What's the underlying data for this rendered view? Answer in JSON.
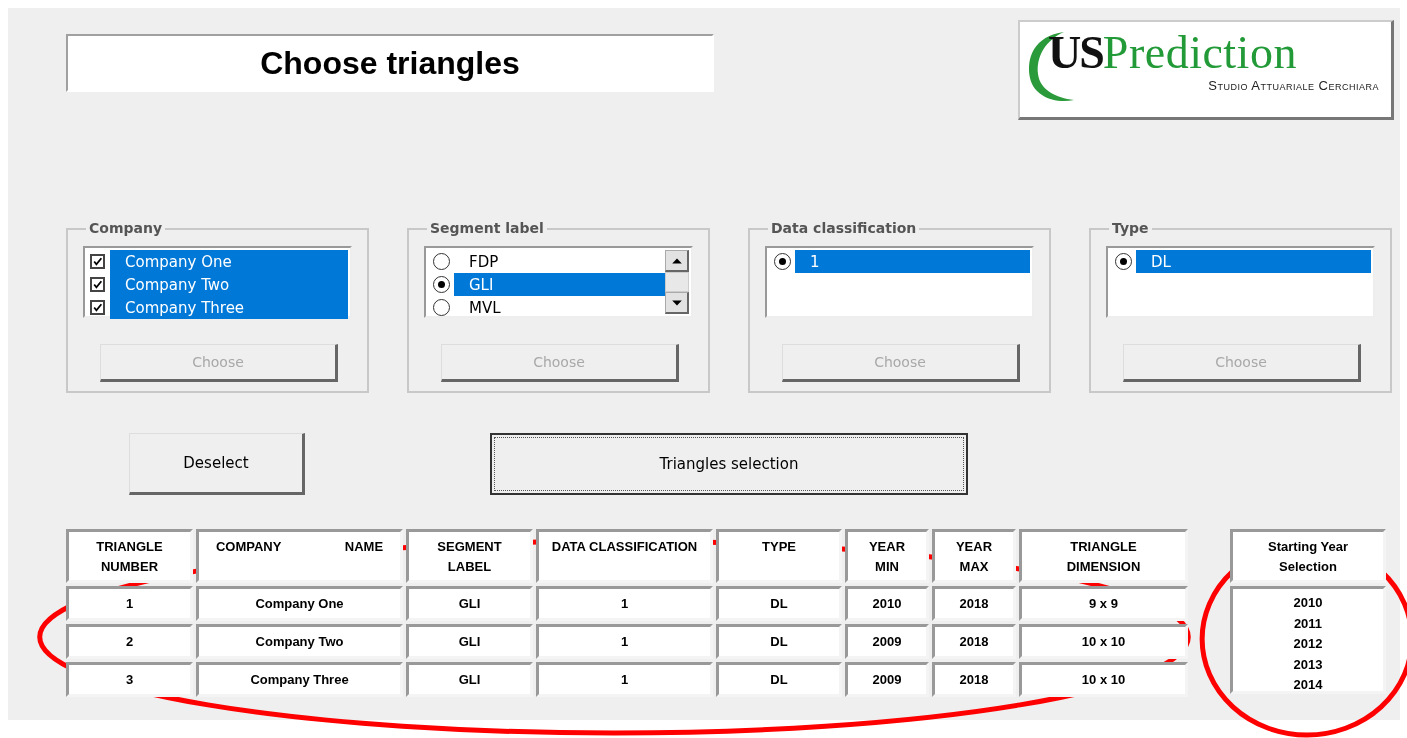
{
  "title": "Choose triangles",
  "logo": {
    "mark": "US",
    "word": "Prediction",
    "tagline": "Studio Attuariale Cerchiara"
  },
  "filters": [
    {
      "label": "Company",
      "kind": "checklist",
      "items": [
        {
          "label": "Company One",
          "checked": true,
          "selected": true
        },
        {
          "label": "Company Two",
          "checked": true,
          "selected": true
        },
        {
          "label": "Company Three",
          "checked": true,
          "selected": true
        }
      ],
      "button": {
        "label": "Choose",
        "disabled": true
      }
    },
    {
      "label": "Segment label",
      "kind": "radiolist",
      "scrollbar": true,
      "items": [
        {
          "label": "FDP",
          "selected": false
        },
        {
          "label": "GLI",
          "selected": true
        },
        {
          "label": "MVL",
          "selected": false
        }
      ],
      "button": {
        "label": "Choose",
        "disabled": true
      }
    },
    {
      "label": "Data classification",
      "kind": "radiolist",
      "items": [
        {
          "label": "1",
          "selected": true
        }
      ],
      "button": {
        "label": "Choose",
        "disabled": true
      }
    },
    {
      "label": "Type",
      "kind": "radiolist",
      "items": [
        {
          "label": "DL",
          "selected": true
        }
      ],
      "button": {
        "label": "Choose",
        "disabled": true
      }
    }
  ],
  "actions": [
    {
      "label": "Deselect",
      "focused": false
    },
    {
      "label": "Triangles selection",
      "focused": true
    }
  ],
  "table": {
    "circled": true,
    "columns": [
      "TRIANGLE\nNUMBER",
      "COMPANY NAME",
      "SEGMENT\nLABEL",
      "DATA CLASSIFICATION",
      "TYPE",
      "YEAR\nMIN",
      "YEAR\nMAX",
      "TRIANGLE\nDIMENSION"
    ],
    "rows": [
      [
        "1",
        "Company One",
        "GLI",
        "1",
        "DL",
        "2010",
        "2018",
        "9 x 9"
      ],
      [
        "2",
        "Company Two",
        "GLI",
        "1",
        "DL",
        "2009",
        "2018",
        "10 x 10"
      ],
      [
        "3",
        "Company Three",
        "GLI",
        "1",
        "DL",
        "2009",
        "2018",
        "10 x 10"
      ]
    ]
  },
  "starting_year": {
    "circled": true,
    "title": "Starting Year\nSelection",
    "items": [
      "2010",
      "2011",
      "2012",
      "2013",
      "2014"
    ]
  }
}
